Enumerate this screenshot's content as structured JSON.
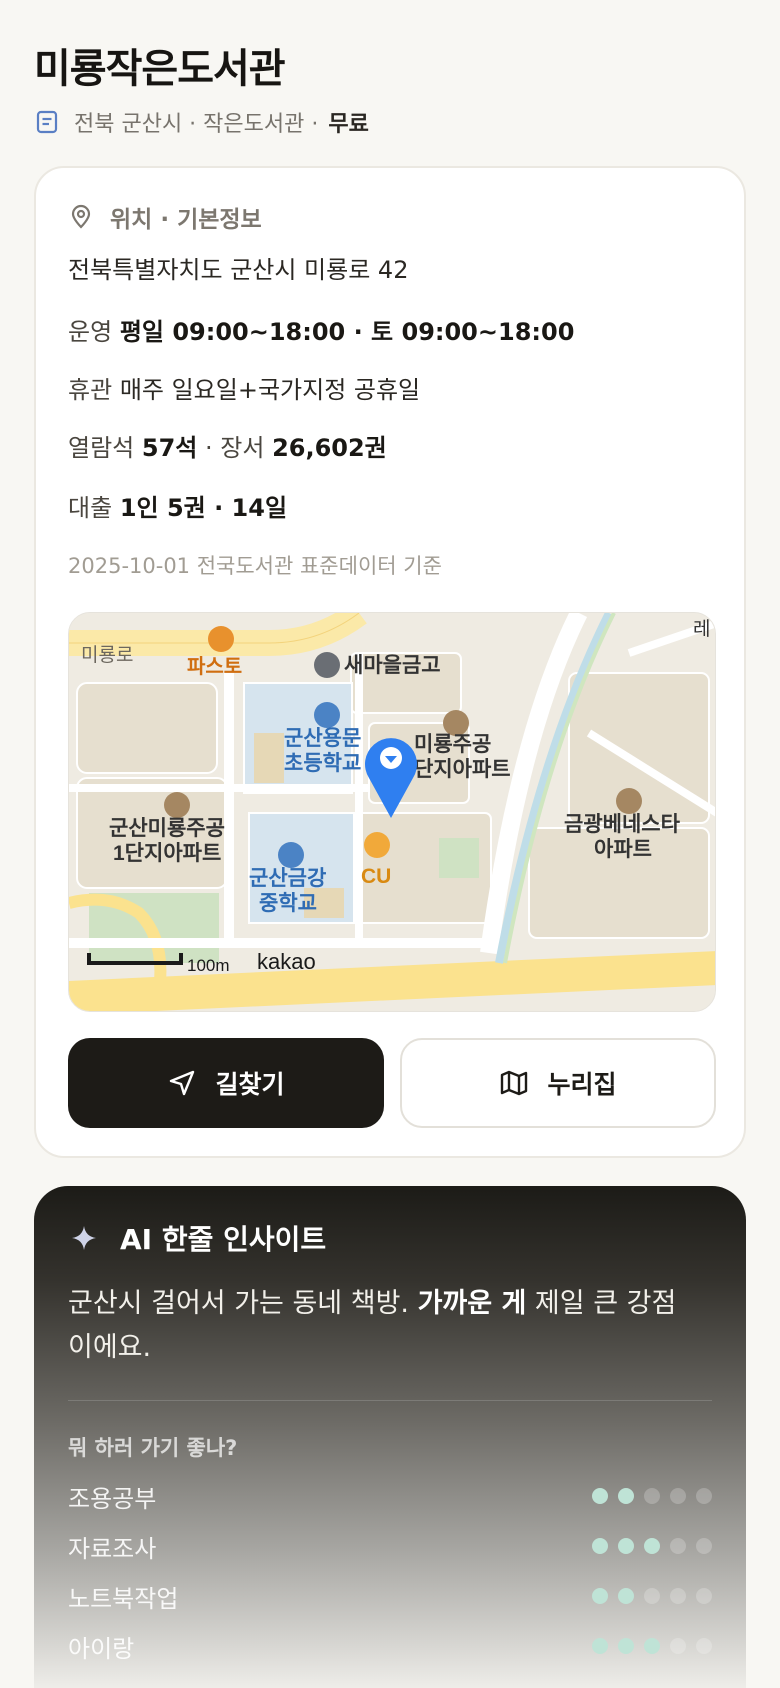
{
  "header": {
    "title": "미룡작은도서관",
    "subline": "전북 군산시 · 작은도서관 · ",
    "fee": "무료"
  },
  "info": {
    "section_title": "위치 · 기본정보",
    "address": "전북특별자치도 군산시 미룡로 42",
    "hours_label": "운영",
    "hours_value": "평일 09:00~18:00 · 토 09:00~18:00",
    "closed_label": "휴관",
    "closed_value": "매주 일요일+국가지정 공휴일",
    "seats_label": "열람석",
    "seats_value": "57석",
    "books_label": " · 장서 ",
    "books_value": "26,602권",
    "loan_label": "대출",
    "loan_value": "1인 5권 · 14일",
    "source": "2025-10-01 전국도서관 표준데이터 기준"
  },
  "map": {
    "road_label": "미룡로",
    "poi_pasta": "파스토",
    "poi_bank": "새마을금고",
    "poi_school1_a": "군산용문",
    "poi_school1_b": "초등학교",
    "poi_apt1_a": "미룡주공",
    "poi_apt1_b": "단지아파트",
    "poi_apt2_a": "군산미룡주공",
    "poi_apt2_b": "1단지아파트",
    "poi_school2_a": "군산금강",
    "poi_school2_b": "중학교",
    "poi_cu": "CU",
    "poi_apt3_a": "금광베네스타",
    "poi_apt3_b": "아파트",
    "poi_edge": "레",
    "scale": "100m",
    "brand": "kakao"
  },
  "actions": {
    "directions": "길찾기",
    "homepage": "누리집"
  },
  "insight": {
    "title": "AI 한줄 인사이트",
    "text_pre": "군산시 걸어서 가는 동네 책방. ",
    "text_bold": "가까운 게",
    "text_post": " 제일 큰 강점이에요.",
    "question": "뭐 하러 가기 좋나?",
    "activities": [
      {
        "name": "조용공부",
        "rating": 2
      },
      {
        "name": "자료조사",
        "rating": 3
      },
      {
        "name": "노트북작업",
        "rating": 2
      },
      {
        "name": "아이랑",
        "rating": 3
      }
    ]
  },
  "colors": {
    "accent_dark": "#1d1b17",
    "dot_on": "#bfe3d6",
    "map_pin": "#2f7ff0"
  }
}
